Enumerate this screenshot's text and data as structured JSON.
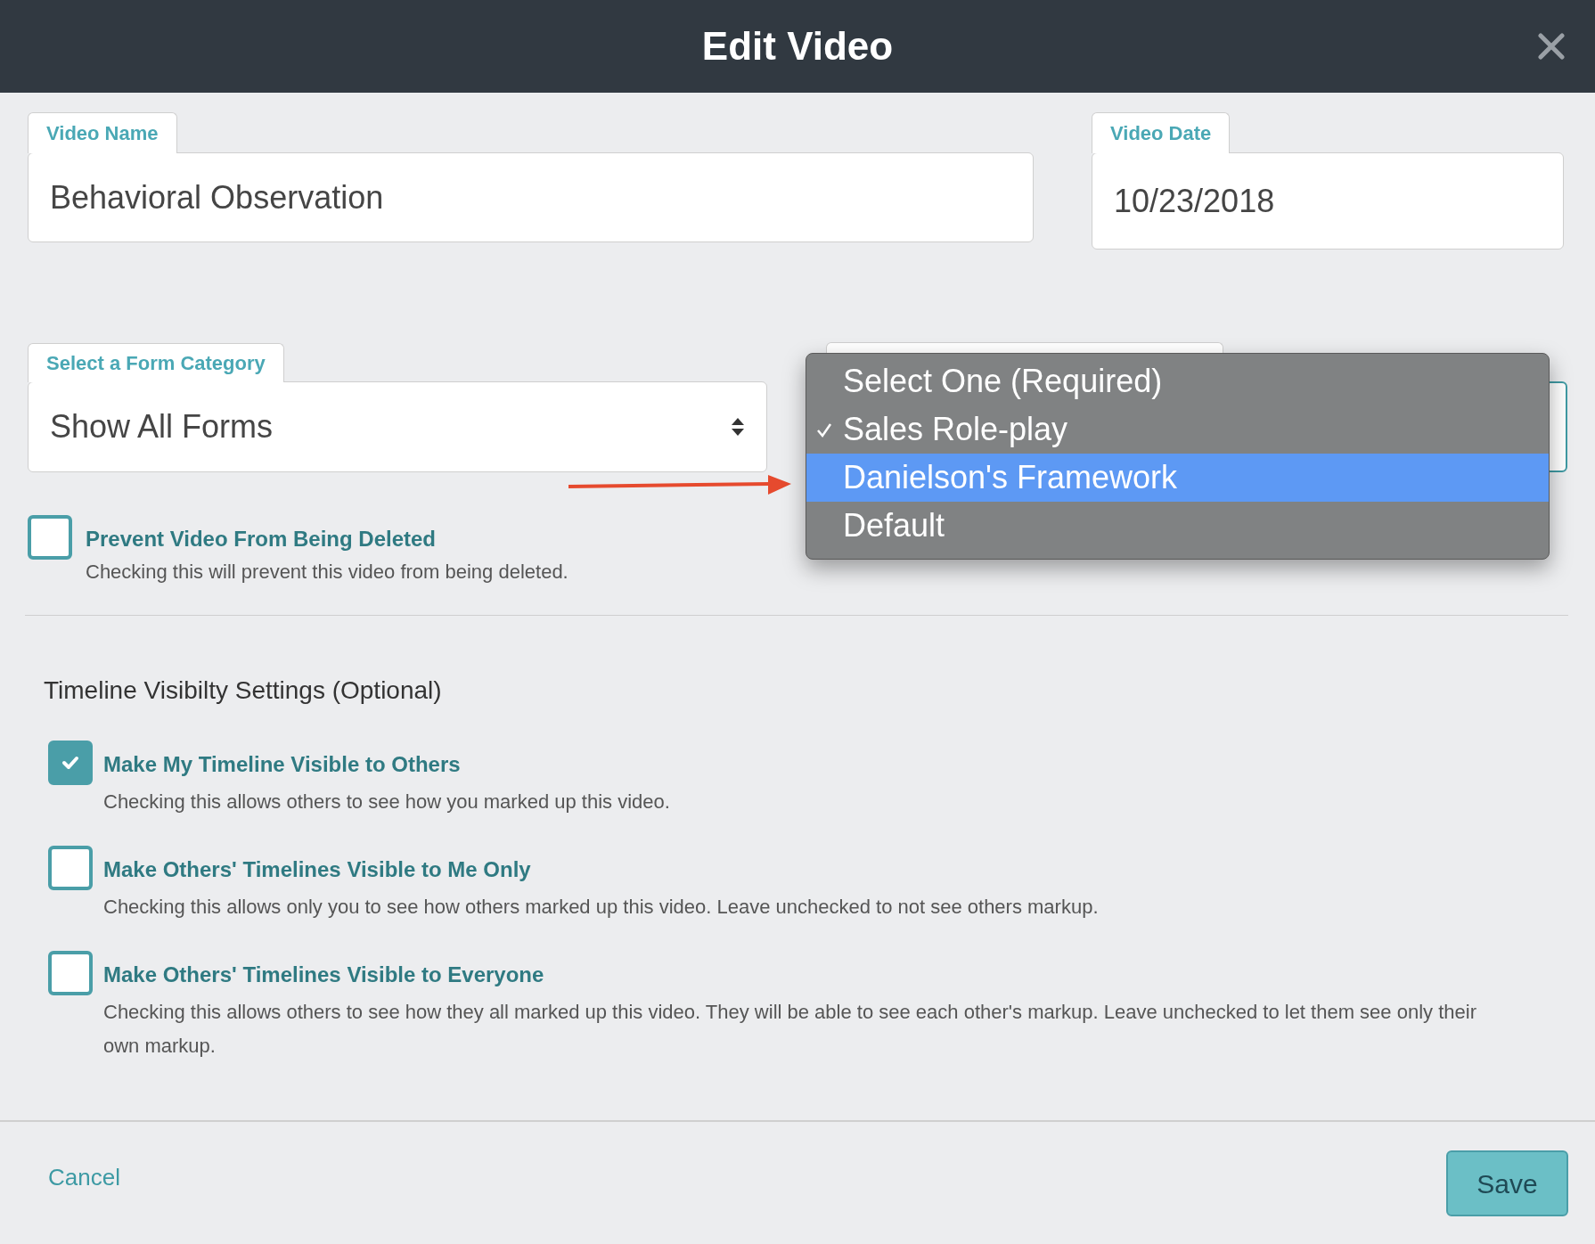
{
  "window": {
    "title": "Edit Video"
  },
  "video_name": {
    "label": "Video Name",
    "value": "Behavioral Observation"
  },
  "video_date": {
    "label": "Video Date",
    "value": "10/23/2018"
  },
  "form_category": {
    "label": "Select a Form Category",
    "value": "Show All Forms"
  },
  "form_dropdown": {
    "options": [
      {
        "label": "Select One (Required)",
        "checked": false,
        "highlighted": false
      },
      {
        "label": "Sales Role-play",
        "checked": true,
        "highlighted": false
      },
      {
        "label": "Danielson's Framework",
        "checked": false,
        "highlighted": true
      },
      {
        "label": "Default",
        "checked": false,
        "highlighted": false
      }
    ]
  },
  "prevent_delete": {
    "label": "Prevent Video From Being Deleted",
    "description": "Checking this will prevent this video from being deleted.",
    "checked": false
  },
  "timeline_settings": {
    "heading": "Timeline Visibilty Settings (Optional)",
    "options": [
      {
        "label": "Make My Timeline Visible to Others",
        "description": "Checking this allows others to see how you marked up this video.",
        "checked": true
      },
      {
        "label": "Make Others' Timelines Visible to Me Only",
        "description": "Checking this allows only you to see how others marked up this video. Leave unchecked to not see others markup.",
        "checked": false
      },
      {
        "label": "Make Others' Timelines Visible to Everyone",
        "description": "Checking this allows others to see how they all marked up this video. They will be able to see each other's markup. Leave unchecked to let them see only their own markup.",
        "checked": false
      }
    ]
  },
  "footer": {
    "cancel": "Cancel",
    "save": "Save"
  }
}
